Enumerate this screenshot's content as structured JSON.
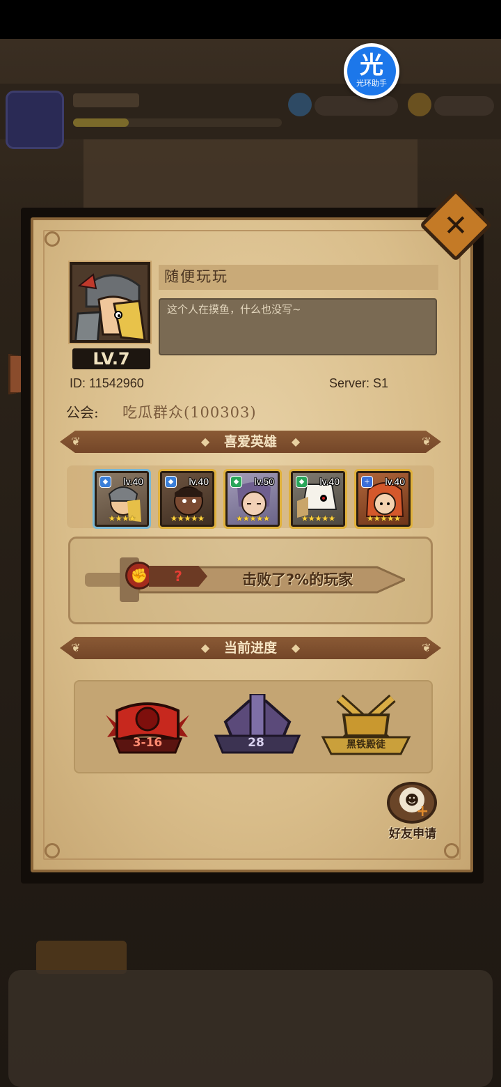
{
  "badge": {
    "glyph": "光",
    "label": "光环助手"
  },
  "profile": {
    "level": "LV.7",
    "nickname": "随便玩玩",
    "signature": "这个人在摸鱼，什么也没写~",
    "id_text": "ID:  11542960",
    "server_text": "Server: S1",
    "guild_label": "公会:",
    "guild_value": "吃瓜群众(100303)"
  },
  "sections": {
    "favorite_heroes": "喜爱英雄",
    "current_progress": "当前进度"
  },
  "heroes": [
    {
      "level": "lv.40",
      "element": "water",
      "element_glyph": "◆",
      "element_color": "#3b7fd8",
      "stars": "★★★★",
      "bg": "#7a6a58"
    },
    {
      "level": "lv.40",
      "element": "water",
      "element_glyph": "◆",
      "element_color": "#3b7fd8",
      "stars": "★★★★★",
      "bg": "#5c4634"
    },
    {
      "level": "lv.50",
      "element": "wind",
      "element_glyph": "◆",
      "element_color": "#2aa65a",
      "stars": "★★★★★",
      "bg": "#8f86a8"
    },
    {
      "level": "lv.40",
      "element": "wind",
      "element_glyph": "◆",
      "element_color": "#2aa65a",
      "stars": "★★★★★",
      "bg": "#6f6b63"
    },
    {
      "level": "lv.40",
      "element": "holy",
      "element_glyph": "+",
      "element_color": "#3b6fd8",
      "stars": "★★★★★",
      "bg": "#a2532b"
    }
  ],
  "power": {
    "rank": "?",
    "defeat_text": "击败了?%的玩家"
  },
  "progress": [
    {
      "label": "3-16",
      "icon": "red-tome-icon",
      "color": "#b2231c"
    },
    {
      "label": "28",
      "icon": "purple-tower-icon",
      "color": "#6a5b8f"
    },
    {
      "label": "黑铁殿徒",
      "icon": "gold-crossed-swords-icon",
      "color": "#caa03b"
    }
  ],
  "friend_request": {
    "label": "好友申请"
  }
}
